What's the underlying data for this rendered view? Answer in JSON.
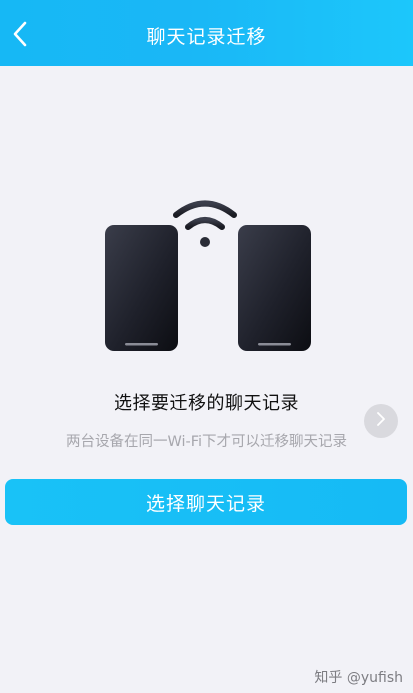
{
  "header": {
    "title": "聊天记录迁移",
    "back_icon": "chevron-left-icon"
  },
  "main": {
    "heading": "选择要迁移的聊天记录",
    "subtext": "两台设备在同一Wi-Fi下才可以迁移聊天记录",
    "illustration_icons": [
      "phone-icon",
      "wifi-icon",
      "phone-icon"
    ],
    "side_button_icon": "chevron-right-icon",
    "primary_button_label": "选择聊天记录"
  },
  "watermark": {
    "text": "知乎 @yufish"
  },
  "colors": {
    "brand": "#16b8f5",
    "background": "#f2f2f7",
    "heading_text": "#111111",
    "subtext": "#a7a7ad"
  }
}
